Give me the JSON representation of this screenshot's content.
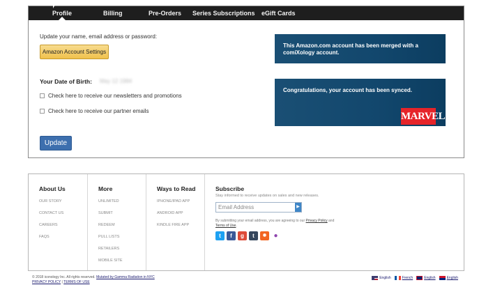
{
  "tabs": [
    {
      "label": "Profile",
      "active": true
    },
    {
      "label": "Billing",
      "active": false
    },
    {
      "label": "Pre-Orders",
      "active": false
    },
    {
      "label": "Series Subscriptions",
      "active": false
    },
    {
      "label": "eGift Cards",
      "active": false
    }
  ],
  "profile": {
    "update_text": "Update your name, email address or password:",
    "settings_button": "Amazon Account Settings",
    "dob_label": "Your Date of Birth:",
    "dob_value": "May 12 1984",
    "newsletter_label": "Check here to receive our newsletters and promotions",
    "partner_label": "Check here to receive our partner emails",
    "update_button": "Update"
  },
  "notices": {
    "merged": "This Amazon.com account has been merged with a comiXology account.",
    "synced": "Congratulations, your account has been synced.",
    "marvel_logo": "MARVEL"
  },
  "footer": {
    "about": {
      "title": "About Us",
      "links": [
        "OUR STORY",
        "CONTACT US",
        "CAREERS",
        "FAQS"
      ]
    },
    "more": {
      "title": "More",
      "links": [
        "UNLIMITED",
        "SUBMIT",
        "REDEEM",
        "PULL LISTS",
        "RETAILERS",
        "MOBILE SITE"
      ]
    },
    "ways": {
      "title": "Ways to Read",
      "links": [
        "IPHONE/IPAD APP",
        "ANDROID APP",
        "KINDLE FIRE APP"
      ]
    },
    "subscribe": {
      "title": "Subscribe",
      "description": "Stay informed to receive updates on sales and new releases.",
      "email_placeholder": "Email Address",
      "go_glyph": "▶",
      "terms_prefix": "By submitting your email address, you are agreeing to our",
      "privacy_link": "Privacy Policy",
      "terms_and": "and",
      "terms_link": "Terms of Use",
      "terms_suffix": "."
    },
    "socials": [
      {
        "name": "twitter-icon",
        "glyph": "t",
        "color": "#1da1f2"
      },
      {
        "name": "facebook-icon",
        "glyph": "f",
        "color": "#3b5998"
      },
      {
        "name": "google-plus-icon",
        "glyph": "g",
        "color": "#dd4b39"
      },
      {
        "name": "tumblr-icon",
        "glyph": "t",
        "color": "#35465c"
      },
      {
        "name": "rss-icon",
        "glyph": "◉",
        "color": "#f26522"
      },
      {
        "name": "podcast-icon",
        "glyph": "●",
        "color": "#8e44ad"
      }
    ]
  },
  "bottom": {
    "copyright": "© 2018 iconology Inc. All rights reserved.",
    "mutated": "Mutated by Gamma Radiation in NYC",
    "privacy": "PRIVACY POLICY",
    "divider": "|",
    "terms": "TERMS OF USE",
    "languages": [
      "English",
      "French",
      "English",
      "English"
    ]
  }
}
